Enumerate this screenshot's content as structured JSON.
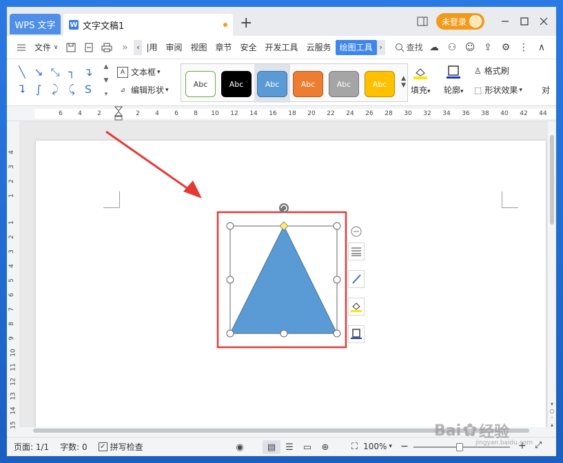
{
  "app": {
    "app_tab": "WPS 文字",
    "doc_tab": "文字文稿1",
    "add_tab": "+",
    "login": "未登录",
    "window_controls": [
      "minimize-icon",
      "maximize-icon",
      "close-icon"
    ]
  },
  "menu": {
    "file": "文件",
    "tabs": [
      "|用",
      "审阅",
      "视图",
      "章节",
      "安全",
      "开发工具",
      "云服务",
      "绘图工具"
    ],
    "active_tab": "绘图工具",
    "search": "查找"
  },
  "ribbon": {
    "textbox": "文本框",
    "edit_shape": "编辑形状",
    "style_presets": [
      {
        "label": "Abc",
        "bg": "#ffffff",
        "fg": "#333333",
        "border": "#70a845"
      },
      {
        "label": "Abc",
        "bg": "#000000",
        "fg": "#ffffff",
        "border": "#000000"
      },
      {
        "label": "Abc",
        "bg": "#5b9bd5",
        "fg": "#ffffff",
        "border": "#41719c"
      },
      {
        "label": "Abc",
        "bg": "#ed7d31",
        "fg": "#ffffff",
        "border": "#ae5a21"
      },
      {
        "label": "Abc",
        "bg": "#a5a5a5",
        "fg": "#ffffff",
        "border": "#787878"
      },
      {
        "label": "Abc",
        "bg": "#ffc000",
        "fg": "#ffffff",
        "border": "#bc8c00"
      }
    ],
    "fill": "填充",
    "outline": "轮廓",
    "format_painter": "格式刷",
    "shape_effects": "形状效果",
    "cut_off": "对"
  },
  "ruler": {
    "h_ticks": [
      "6",
      "4",
      "2",
      "2",
      "4",
      "6",
      "8",
      "10",
      "12",
      "14",
      "16",
      "18",
      "20",
      "22",
      "24",
      "26",
      "28",
      "30",
      "32",
      "34",
      "36",
      "38",
      "40",
      "42",
      "44"
    ],
    "v_ticks": [
      "4",
      "3",
      "2",
      "1",
      "1",
      "2",
      "3",
      "4",
      "5",
      "6",
      "7",
      "8",
      "9",
      "10",
      "11",
      "12",
      "13",
      "14",
      "15"
    ]
  },
  "shape": {
    "fill_color": "#5b9bd5",
    "stroke_color": "#41719c",
    "highlight_color": "#e53935"
  },
  "status": {
    "page": "页面: 1/1",
    "words": "字数: 0",
    "spell": "拼写检查",
    "zoom": "100%"
  },
  "watermark": {
    "brand": "Bai",
    "brand2": "经验",
    "domain": "jingyan.baidu.com"
  }
}
